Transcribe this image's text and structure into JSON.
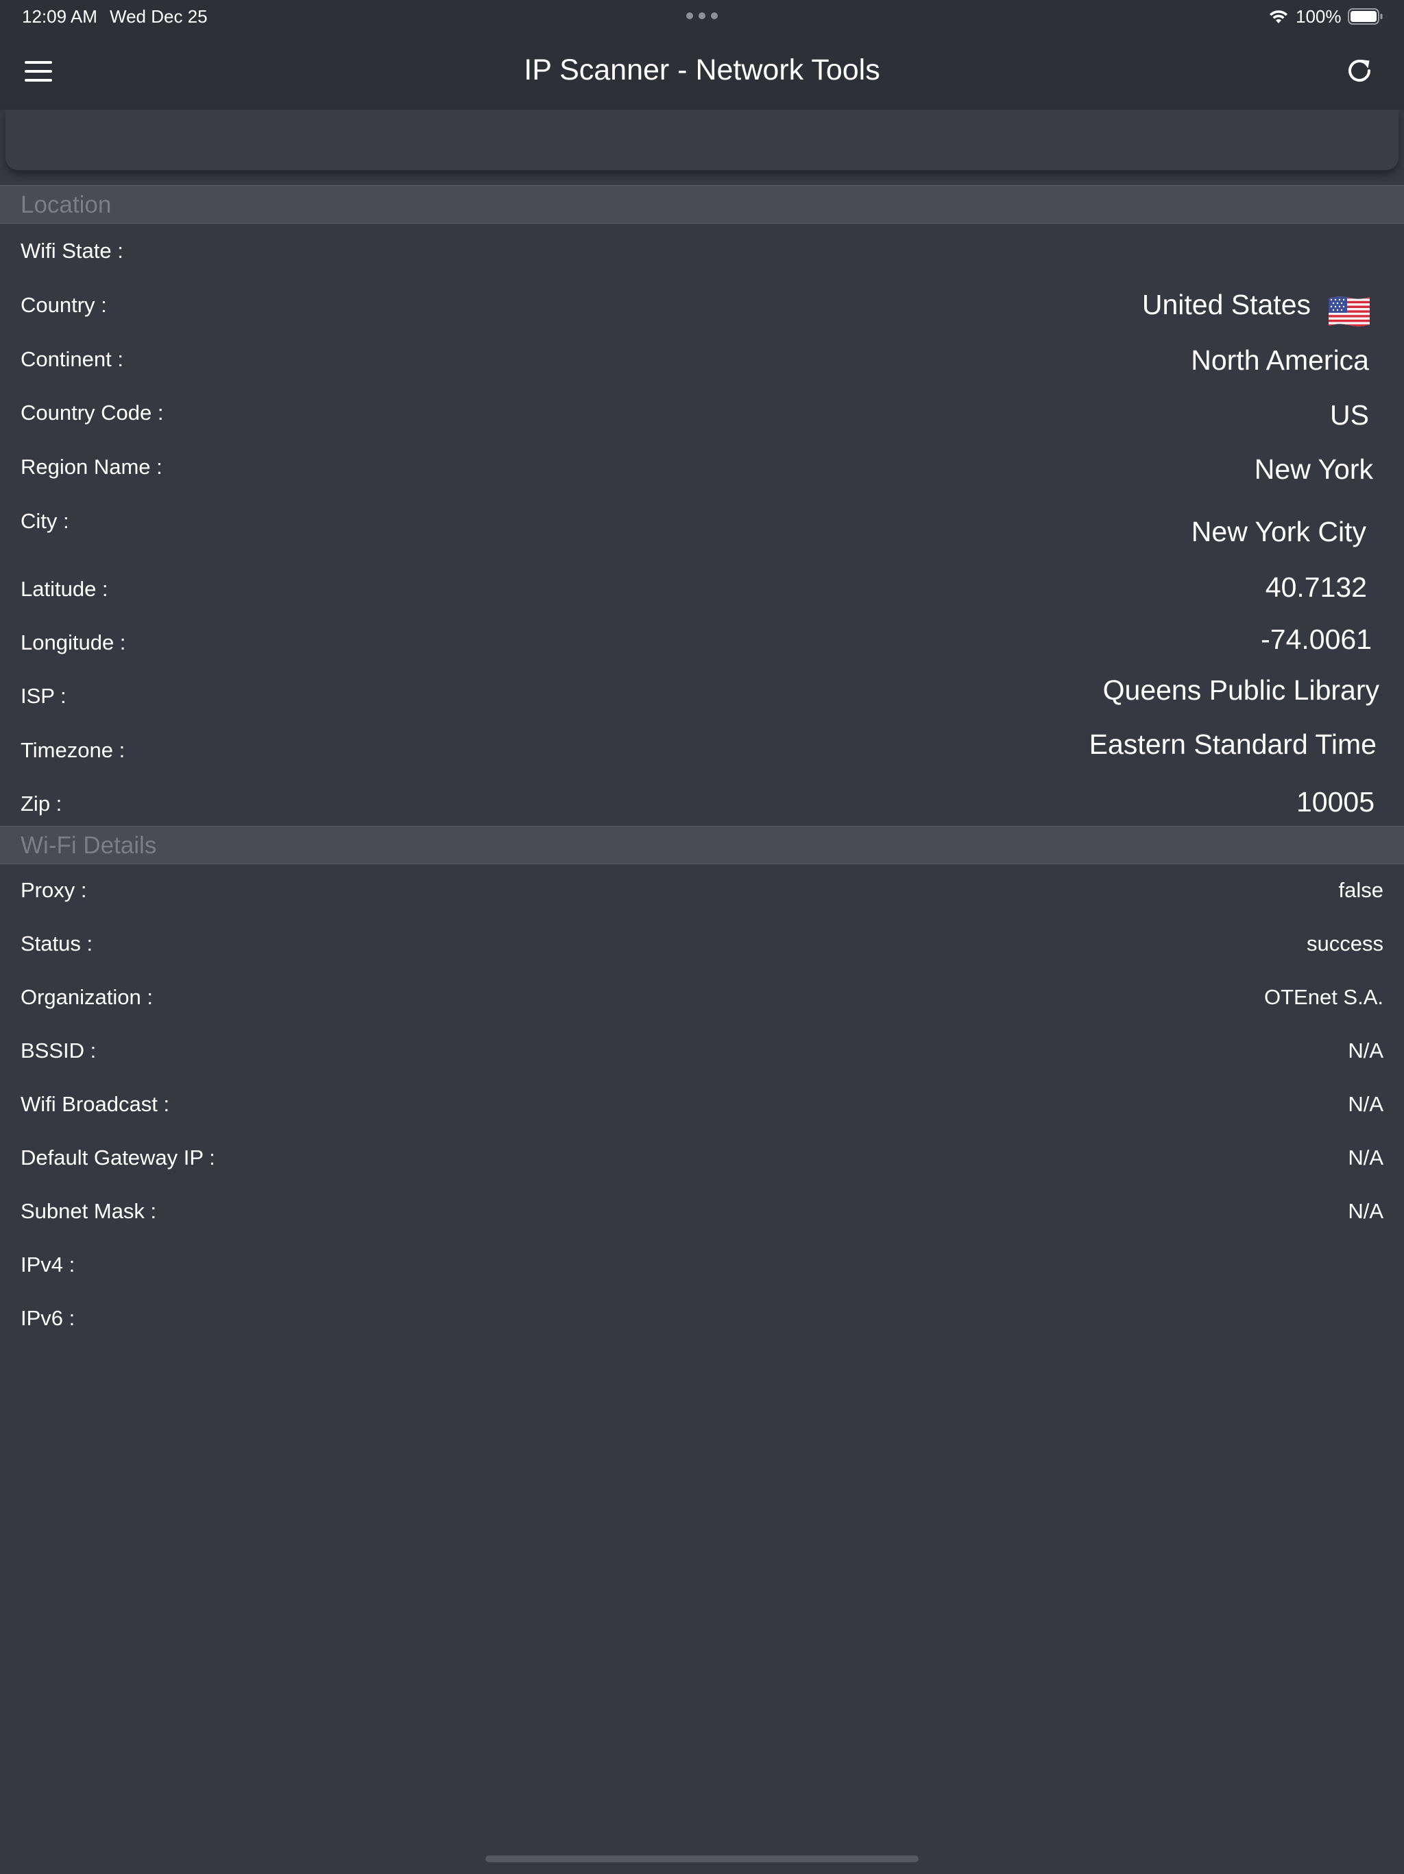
{
  "status_bar": {
    "time": "12:09 AM",
    "date": "Wed Dec 25",
    "battery_percent": "100%"
  },
  "nav": {
    "title": "IP Scanner - Network Tools",
    "left_icon": "menu-icon",
    "right_icon": "refresh-icon"
  },
  "location": {
    "header": "Location",
    "rows": [
      {
        "label": "Wifi State :",
        "value": ""
      },
      {
        "label": "Country :",
        "value": "United States",
        "icon": "us-flag-icon"
      },
      {
        "label": "Continent :",
        "value": "North America"
      },
      {
        "label": "Country Code :",
        "value": "US"
      },
      {
        "label": "Region Name :",
        "value": "New York"
      },
      {
        "label": "City :",
        "value": "New York City"
      },
      {
        "label": "Latitude :",
        "value": "40.7132"
      },
      {
        "label": "Longitude :",
        "value": "-74.0061"
      },
      {
        "label": "ISP :",
        "value": "Queens Public Library"
      },
      {
        "label": "Timezone :",
        "value": "Eastern Standard Time"
      },
      {
        "label": "Zip :",
        "value": "10005"
      }
    ]
  },
  "wifi_details": {
    "header": "Wi-Fi Details",
    "rows": [
      {
        "label": "Proxy :",
        "value": "false"
      },
      {
        "label": "Status :",
        "value": "success"
      },
      {
        "label": "Organization :",
        "value": "OTEnet S.A."
      },
      {
        "label": "BSSID :",
        "value": "N/A"
      },
      {
        "label": "Wifi Broadcast :",
        "value": "N/A"
      },
      {
        "label": "Default Gateway IP :",
        "value": "N/A"
      },
      {
        "label": "Subnet Mask :",
        "value": "N/A"
      },
      {
        "label": "IPv4 :",
        "value": ""
      },
      {
        "label": "IPv6 :",
        "value": ""
      }
    ]
  },
  "colors": {
    "background": "#363941",
    "bar": "#2d3036",
    "section_header": "#494c53",
    "section_header_text": "#7b7e85",
    "text": "#ffffff"
  }
}
